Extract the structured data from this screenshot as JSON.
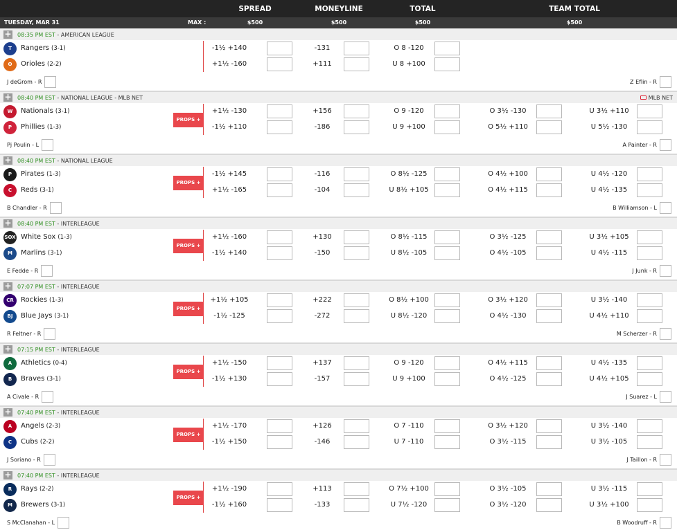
{
  "header": {
    "columns": [
      "SPREAD",
      "MONEYLINE",
      "TOTAL",
      "TEAM TOTAL"
    ],
    "date": "TUESDAY, MAR 31",
    "max_label": "MAX :",
    "max_values": [
      "$500",
      "$500",
      "$500",
      "$500"
    ]
  },
  "props_label": "PROPS +",
  "games": [
    {
      "time": "08:35 PM EST",
      "sep": " - ",
      "league": "AMERICAN LEAGUE",
      "tv": "",
      "has_props": false,
      "teams": [
        {
          "name": "Rangers",
          "record": "(3-1)",
          "logo": "rangers-logo",
          "logo_text": "T",
          "logo_color": "#1d3f8e",
          "spread": "-1½ +140",
          "ml": "-131",
          "total": "O 8 -120",
          "tt1": "",
          "tt2": ""
        },
        {
          "name": "Orioles",
          "record": "(2-2)",
          "logo": "orioles-logo",
          "logo_text": "O",
          "logo_color": "#e06b18",
          "spread": "+1½ -160",
          "ml": "+111",
          "total": "U 8 +100",
          "tt1": "",
          "tt2": ""
        }
      ],
      "pitcher_away": "J deGrom - R",
      "pitcher_home": "Z Eflin - R"
    },
    {
      "time": "08:40 PM EST",
      "sep": " - ",
      "league": "NATIONAL LEAGUE - MLB NET",
      "tv": "MLB NET",
      "has_props": true,
      "teams": [
        {
          "name": "Nationals",
          "record": "(3-1)",
          "logo": "nationals-logo",
          "logo_text": "W",
          "logo_color": "#c4192f",
          "spread": "+1½ -130",
          "ml": "+156",
          "total": "O 9 -120",
          "tt1": "O 3½ -130",
          "tt2": "U 3½ +110"
        },
        {
          "name": "Phillies",
          "record": "(1-3)",
          "logo": "phillies-logo",
          "logo_text": "P",
          "logo_color": "#d0233b",
          "spread": "-1½ +110",
          "ml": "-186",
          "total": "U 9 +100",
          "tt1": "O 5½ +110",
          "tt2": "U 5½ -130"
        }
      ],
      "pitcher_away": "Pj Poulin - L",
      "pitcher_home": "A Painter - R"
    },
    {
      "time": "08:40 PM EST",
      "sep": " - ",
      "league": "NATIONAL LEAGUE",
      "tv": "",
      "has_props": true,
      "teams": [
        {
          "name": "Pirates",
          "record": "(1-3)",
          "logo": "pirates-logo",
          "logo_text": "P",
          "logo_color": "#1a1a1a",
          "spread": "-1½ +145",
          "ml": "-116",
          "total": "O 8½ -125",
          "tt1": "O 4½ +100",
          "tt2": "U 4½ -120"
        },
        {
          "name": "Reds",
          "record": "(3-1)",
          "logo": "reds-logo",
          "logo_text": "C",
          "logo_color": "#c8102e",
          "spread": "+1½ -165",
          "ml": "-104",
          "total": "U 8½ +105",
          "tt1": "O 4½ +115",
          "tt2": "U 4½ -135"
        }
      ],
      "pitcher_away": "B Chandler - R",
      "pitcher_home": "B Williamson - L"
    },
    {
      "time": "08:40 PM EST",
      "sep": " - ",
      "league": "INTERLEAGUE",
      "tv": "",
      "has_props": true,
      "teams": [
        {
          "name": "White Sox",
          "record": "(1-3)",
          "logo": "white-sox-logo",
          "logo_text": "SOX",
          "logo_color": "#222222",
          "spread": "+1½ -160",
          "ml": "+130",
          "total": "O 8½ -115",
          "tt1": "O 3½ -125",
          "tt2": "U 3½ +105"
        },
        {
          "name": "Marlins",
          "record": "(3-1)",
          "logo": "marlins-logo",
          "logo_text": "M",
          "logo_color": "#1b4a8a",
          "spread": "-1½ +140",
          "ml": "-150",
          "total": "U 8½ -105",
          "tt1": "O 4½ -105",
          "tt2": "U 4½ -115"
        }
      ],
      "pitcher_away": "E Fedde - R",
      "pitcher_home": "J Junk - R"
    },
    {
      "time": "07:07 PM EST",
      "sep": " - ",
      "league": "INTERLEAGUE",
      "tv": "",
      "has_props": true,
      "teams": [
        {
          "name": "Rockies",
          "record": "(1-3)",
          "logo": "rockies-logo",
          "logo_text": "CR",
          "logo_color": "#33006f",
          "spread": "+1½ +105",
          "ml": "+222",
          "total": "O 8½ +100",
          "tt1": "O 3½ +120",
          "tt2": "U 3½ -140"
        },
        {
          "name": "Blue Jays",
          "record": "(3-1)",
          "logo": "blue-jays-logo",
          "logo_text": "BJ",
          "logo_color": "#134a8e",
          "spread": "-1½ -125",
          "ml": "-272",
          "total": "U 8½ -120",
          "tt1": "O 4½ -130",
          "tt2": "U 4½ +110"
        }
      ],
      "pitcher_away": "R Feltner - R",
      "pitcher_home": "M Scherzer - R"
    },
    {
      "time": "07:15 PM EST",
      "sep": " - ",
      "league": "INTERLEAGUE",
      "tv": "",
      "has_props": true,
      "teams": [
        {
          "name": "Athletics",
          "record": "(0-4)",
          "logo": "athletics-logo",
          "logo_text": "A",
          "logo_color": "#0f6b3e",
          "spread": "+1½ -150",
          "ml": "+137",
          "total": "O 9 -120",
          "tt1": "O 4½ +115",
          "tt2": "U 4½ -135"
        },
        {
          "name": "Braves",
          "record": "(3-1)",
          "logo": "braves-logo",
          "logo_text": "B",
          "logo_color": "#13274f",
          "spread": "-1½ +130",
          "ml": "-157",
          "total": "U 9 +100",
          "tt1": "O 4½ -125",
          "tt2": "U 4½ +105"
        }
      ],
      "pitcher_away": "A Civale - R",
      "pitcher_home": "J Suarez - L"
    },
    {
      "time": "07:40 PM EST",
      "sep": " - ",
      "league": "INTERLEAGUE",
      "tv": "",
      "has_props": true,
      "teams": [
        {
          "name": "Angels",
          "record": "(2-3)",
          "logo": "angels-logo",
          "logo_text": "A",
          "logo_color": "#ba0021",
          "spread": "+1½ -170",
          "ml": "+126",
          "total": "O 7 -110",
          "tt1": "O 3½ +120",
          "tt2": "U 3½ -140"
        },
        {
          "name": "Cubs",
          "record": "(2-2)",
          "logo": "cubs-logo",
          "logo_text": "C",
          "logo_color": "#0e3386",
          "spread": "-1½ +150",
          "ml": "-146",
          "total": "U 7 -110",
          "tt1": "O 3½ -115",
          "tt2": "U 3½ -105"
        }
      ],
      "pitcher_away": "J Soriano - R",
      "pitcher_home": "J Taillon - R"
    },
    {
      "time": "07:40 PM EST",
      "sep": " - ",
      "league": "INTERLEAGUE",
      "tv": "",
      "has_props": true,
      "teams": [
        {
          "name": "Rays",
          "record": "(2-2)",
          "logo": "rays-logo",
          "logo_text": "R",
          "logo_color": "#092c5c",
          "spread": "+1½ -190",
          "ml": "+113",
          "total": "O 7½ +100",
          "tt1": "O 3½ -105",
          "tt2": "U 3½ -115"
        },
        {
          "name": "Brewers",
          "record": "(3-1)",
          "logo": "brewers-logo",
          "logo_text": "M",
          "logo_color": "#12284b",
          "spread": "-1½ +160",
          "ml": "-133",
          "total": "U 7½ -120",
          "tt1": "O 3½ -120",
          "tt2": "U 3½ +100"
        }
      ],
      "pitcher_away": "S McClanahan - L",
      "pitcher_home": "B Woodruff - R"
    }
  ]
}
